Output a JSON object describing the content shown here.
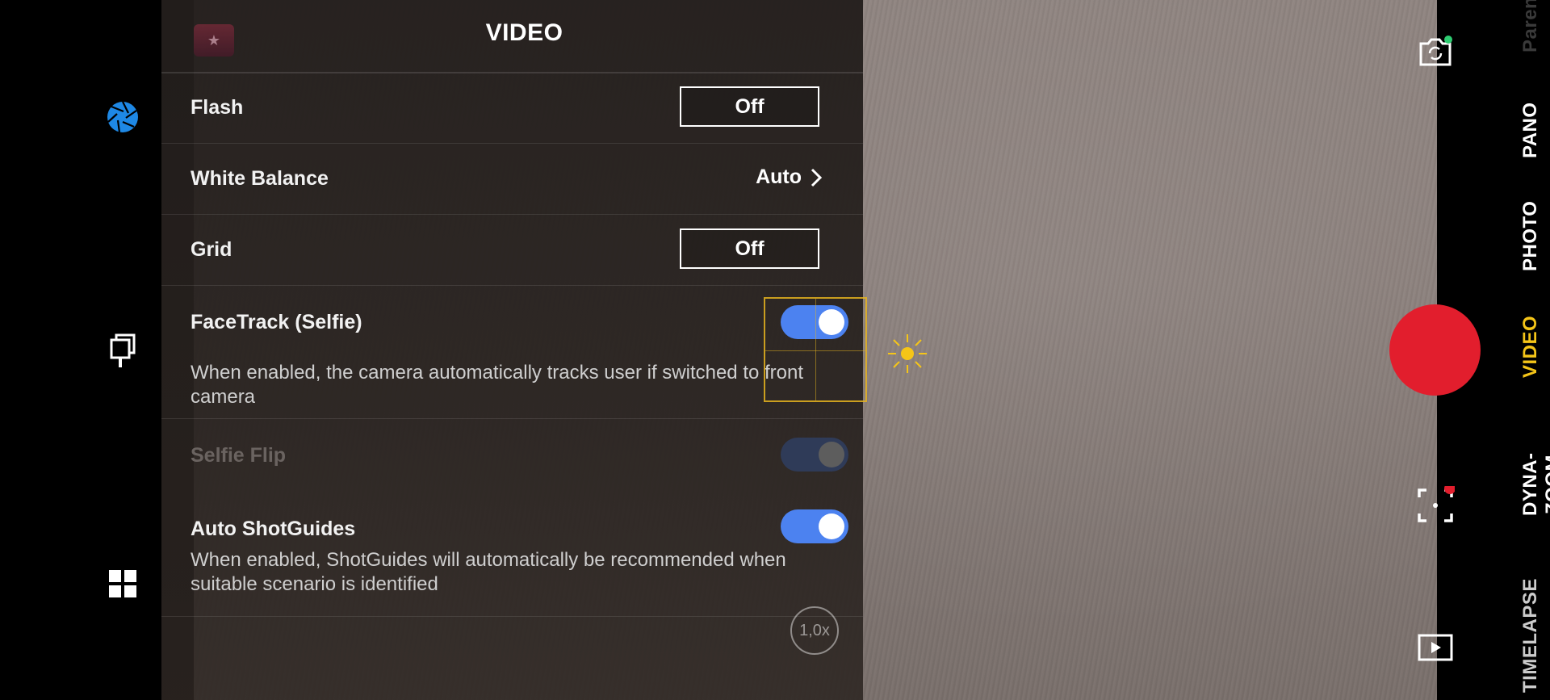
{
  "panel": {
    "title": "VIDEO",
    "logo_icon": "movie-clapper-icon"
  },
  "settings": {
    "flash": {
      "label": "Flash",
      "value": "Off"
    },
    "white_balance": {
      "label": "White Balance",
      "value": "Auto"
    },
    "grid": {
      "label": "Grid",
      "value": "Off"
    },
    "facetrack": {
      "label": "FaceTrack (Selfie)",
      "description": "When enabled, the camera automatically tracks user if switched to front camera",
      "enabled": true
    },
    "selfie_flip": {
      "label": "Selfie Flip",
      "enabled": false,
      "disabled": true
    },
    "auto_shotguides": {
      "label": "Auto ShotGuides",
      "description": "When enabled, ShotGuides will automatically be recommended when suitable scenario is identified",
      "enabled": true
    }
  },
  "viewfinder": {
    "zoom_label": "1,0x"
  },
  "modes": [
    "TIMELAPSE",
    "DYNA-ZOOM",
    "VIDEO",
    "PHOTO",
    "PANO",
    "Paren"
  ],
  "active_mode": "VIDEO",
  "colors": {
    "shutter": "#e21e2d",
    "toggle_on": "#4c82f0",
    "active_mode": "#f5c518",
    "focus": "#e6b41e"
  },
  "icons": {
    "left": [
      "aperture-icon",
      "selfie-stick-icon",
      "grid-apps-icon"
    ],
    "right": [
      "switch-camera-icon",
      "scene-detect-icon",
      "gallery-play-icon"
    ]
  }
}
